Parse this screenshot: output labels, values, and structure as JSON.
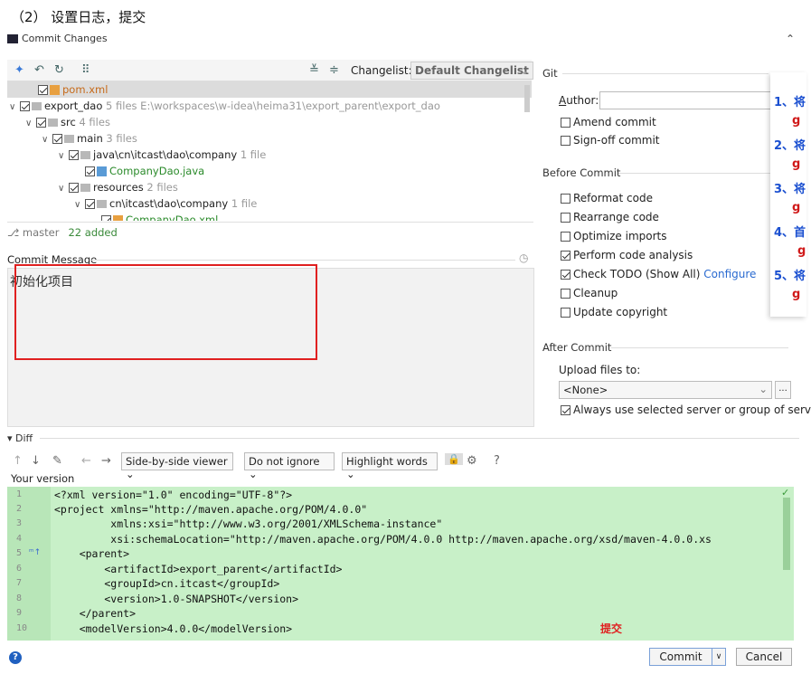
{
  "caption": "（2） 设置日志，提交",
  "dialog": {
    "title": "Commit Changes"
  },
  "toolbar": {
    "changelist_label": "Changelist:",
    "changelist_value": "Default Changelist"
  },
  "tree": [
    {
      "name": "pom.xml",
      "info": "",
      "indent": 2
    },
    {
      "name": "export_dao",
      "info": "5 files  E:\\workspaces\\w-idea\\heima31\\export_parent\\export_dao",
      "indent": 0
    },
    {
      "name": "src",
      "info": "4 files",
      "indent": 1
    },
    {
      "name": "main",
      "info": "3 files",
      "indent": 2
    },
    {
      "name": "java\\cn\\itcast\\dao\\company",
      "info": "1 file",
      "indent": 3
    },
    {
      "name": "CompanyDao.java",
      "info": "",
      "indent": 4
    },
    {
      "name": "resources",
      "info": "2 files",
      "indent": 3
    },
    {
      "name": "cn\\itcast\\dao\\company",
      "info": "1 file",
      "indent": 4
    },
    {
      "name": "CompanyDao.xml",
      "info": "",
      "indent": 5
    }
  ],
  "status": {
    "branch": "master",
    "added": "22 added"
  },
  "commit_message": {
    "label": "Commit Message",
    "text": "初始化项目"
  },
  "git": {
    "header": "Git",
    "author_label": "Author:",
    "author_value": "",
    "amend": "Amend commit",
    "signoff": "Sign-off commit"
  },
  "before_commit": {
    "header": "Before Commit",
    "reformat": "Reformat code",
    "rearrange": "Rearrange code",
    "optimize": "Optimize imports",
    "analysis": "Perform code analysis",
    "todo": "Check TODO (Show All)",
    "configure": "Configure",
    "cleanup": "Cleanup",
    "copyright": "Update copyright"
  },
  "after_commit": {
    "header": "After Commit",
    "upload_label": "Upload files to:",
    "upload_value": "<None>",
    "upload_more": "...",
    "always_use": "Always use selected server or group of servers"
  },
  "diff": {
    "header": "Diff",
    "viewer": "Side-by-side viewer",
    "ignore": "Do not ignore",
    "highlight": "Highlight words",
    "help": "?",
    "your_version": "Your version"
  },
  "code_lines": [
    {
      "n": "1",
      "text": "<?xml version=\"1.0\" encoding=\"UTF-8\"?>"
    },
    {
      "n": "2",
      "text": "<project xmlns=\"http://maven.apache.org/POM/4.0.0\""
    },
    {
      "n": "3",
      "text": "         xmlns:xsi=\"http://www.w3.org/2001/XMLSchema-instance\""
    },
    {
      "n": "4",
      "text": "         xsi:schemaLocation=\"http://maven.apache.org/POM/4.0.0 http://maven.apache.org/xsd/maven-4.0.0.xs"
    },
    {
      "n": "5",
      "text": "    <parent>"
    },
    {
      "n": "6",
      "text": "        <artifactId>export_parent</artifactId>"
    },
    {
      "n": "7",
      "text": "        <groupId>cn.itcast</groupId>"
    },
    {
      "n": "8",
      "text": "        <version>1.0-SNAPSHOT</version>"
    },
    {
      "n": "9",
      "text": "    </parent>"
    },
    {
      "n": "10",
      "text": "    <modelVersion>4.0.0</modelVersion>"
    }
  ],
  "annotation": "提交",
  "buttons": {
    "commit": "Commit",
    "cancel": "Cancel",
    "help": "?"
  },
  "overlay": {
    "items": [
      {
        "num": "1、",
        "ch": "将"
      },
      {
        "num": "",
        "ch": "g"
      },
      {
        "num": "2、",
        "ch": "将"
      },
      {
        "num": "",
        "ch": "g"
      },
      {
        "num": "3、",
        "ch": "将"
      },
      {
        "num": "",
        "ch": "g"
      },
      {
        "num": "4、",
        "ch": "首"
      },
      {
        "num": "",
        "ch": "g"
      },
      {
        "num": "5、",
        "ch": "将"
      },
      {
        "num": "",
        "ch": "g"
      }
    ]
  }
}
